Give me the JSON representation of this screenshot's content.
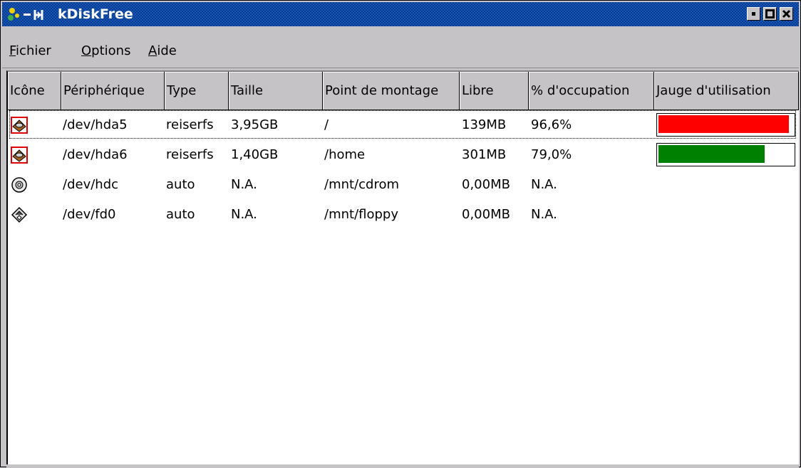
{
  "window": {
    "title": "kDiskFree"
  },
  "menu": {
    "items": [
      {
        "accel": "F",
        "rest": "ichier"
      },
      {
        "accel": "O",
        "rest": "ptions"
      },
      {
        "accel": "A",
        "rest": "ide"
      }
    ]
  },
  "columns": [
    "Icône",
    "Périphérique",
    "Type",
    "Taille",
    "Point de montage",
    "Libre",
    "% d'occupation",
    "Jauge d'utilisation"
  ],
  "rows": [
    {
      "icon": "harddisk-icon",
      "device": "/dev/hda5",
      "type": "reiserfs",
      "size": "3,95GB",
      "mount": "/",
      "free": "139MB",
      "usage": "96,6%",
      "gauge": 0.966,
      "gauge_color": "#ff0000"
    },
    {
      "icon": "harddisk-icon",
      "device": "/dev/hda6",
      "type": "reiserfs",
      "size": "1,40GB",
      "mount": "/home",
      "free": "301MB",
      "usage": "79,0%",
      "gauge": 0.79,
      "gauge_color": "#008000"
    },
    {
      "icon": "cdrom-icon",
      "device": "/dev/hdc",
      "type": "auto",
      "size": "N.A.",
      "mount": "/mnt/cdrom",
      "free": "0,00MB",
      "usage": "N.A.",
      "gauge": null
    },
    {
      "icon": "floppy-icon",
      "device": "/dev/fd0",
      "type": "auto",
      "size": "N.A.",
      "mount": "/mnt/floppy",
      "free": "0,00MB",
      "usage": "N.A.",
      "gauge": null
    }
  ],
  "colors": {
    "titlebar": "#003d9c",
    "gauge_high": "#ff0000",
    "gauge_ok": "#008000"
  }
}
